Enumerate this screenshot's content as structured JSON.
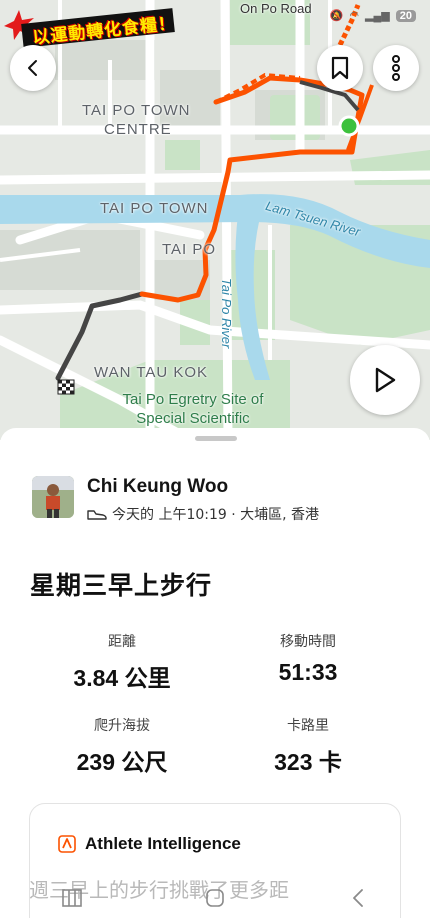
{
  "status_bar": {
    "battery": "20"
  },
  "brand_logo": {
    "text": "以運動轉化食糧！"
  },
  "map": {
    "labels": {
      "on_po_road": "On Po Road",
      "tai_po_town_centre_1": "TAI PO TOWN",
      "tai_po_town_centre_2": "CENTRE",
      "tai_po_town": "TAI PO TOWN",
      "tai_po": "TAI PO",
      "wan_tau_kok": "WAN TAU KOK",
      "lam_tsuen_river": "Lam Tsuen River",
      "tai_po_river": "Tai Po River",
      "egretry_1": "Tai Po Egretry Site of",
      "egretry_2": "Special Scientific"
    },
    "route_colors": {
      "main": "#fc5200",
      "slow": "#444444",
      "start": "#3cc13c"
    }
  },
  "athlete": {
    "name": "Chi Keung Woo",
    "meta": "今天的 上午10:19 · 大埔區, 香港",
    "activity_icon": "shoe-icon"
  },
  "activity": {
    "title": "星期三早上步行",
    "stats": [
      {
        "label": "距離",
        "value": "3.84",
        "unit": "公里"
      },
      {
        "label": "移動時間",
        "value": "51:33",
        "unit": ""
      },
      {
        "label": "爬升海拔",
        "value": "239",
        "unit": "公尺"
      },
      {
        "label": "卡路里",
        "value": "323",
        "unit": "卡"
      }
    ]
  },
  "athlete_intelligence": {
    "title": "Athlete Intelligence",
    "body": "週三早上的步行挑戰了更多距"
  },
  "colors": {
    "accent": "#fc5200"
  }
}
